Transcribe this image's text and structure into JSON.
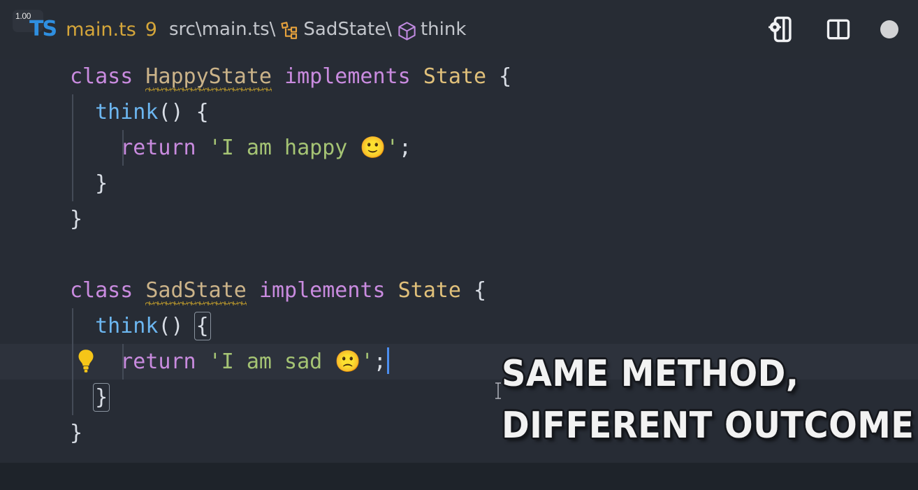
{
  "window": {
    "zoom_badge": "1.00",
    "file_icon": "TS",
    "tab_name": "main.ts",
    "tab_badge": "9",
    "theme": {
      "titlebar_bg": "#272c34",
      "editor_bg": "#272c35",
      "active_line_bg": "#2d323c",
      "accent_blue": "#4c8ef0",
      "tab_amber": "#d5a63a",
      "ts_blue": "#2f8fe0"
    }
  },
  "breadcrumb": {
    "items": [
      {
        "label": "src\\main.ts\\",
        "icon": "none"
      },
      {
        "label": "SadState\\",
        "icon": "class-symbol-icon"
      },
      {
        "label": "think",
        "icon": "method-symbol-icon"
      }
    ]
  },
  "titlebar_actions": [
    {
      "name": "open-settings-panel-icon",
      "label": "Settings"
    },
    {
      "name": "split-editor-icon",
      "label": "Split Editor"
    },
    {
      "name": "unsaved-dot-icon",
      "label": "Unsaved changes"
    }
  ],
  "editor": {
    "lines": [
      {
        "n": 1,
        "tokens": [
          {
            "t": "class",
            "c": "kw"
          },
          {
            "t": " ",
            "c": "punc"
          },
          {
            "t": "HappyState",
            "c": "type squiggle"
          },
          {
            "t": " ",
            "c": "punc"
          },
          {
            "t": "implements",
            "c": "kw"
          },
          {
            "t": " ",
            "c": "punc"
          },
          {
            "t": "State",
            "c": "iface"
          },
          {
            "t": " {",
            "c": "punc"
          }
        ]
      },
      {
        "n": 2,
        "indent": 1,
        "tokens": [
          {
            "t": "  ",
            "c": "punc"
          },
          {
            "t": "think",
            "c": "fn"
          },
          {
            "t": "() {",
            "c": "punc"
          }
        ]
      },
      {
        "n": 3,
        "indent": 2,
        "tokens": [
          {
            "t": "    ",
            "c": "punc"
          },
          {
            "t": "return",
            "c": "kw"
          },
          {
            "t": " ",
            "c": "punc"
          },
          {
            "t": "'I am happy 🙂'",
            "c": "str"
          },
          {
            "t": ";",
            "c": "punc"
          }
        ]
      },
      {
        "n": 4,
        "indent": 1,
        "tokens": [
          {
            "t": "  }",
            "c": "punc"
          }
        ]
      },
      {
        "n": 5,
        "tokens": [
          {
            "t": "}",
            "c": "punc"
          }
        ]
      },
      {
        "n": 6,
        "tokens": []
      },
      {
        "n": 7,
        "tokens": [
          {
            "t": "class",
            "c": "kw"
          },
          {
            "t": " ",
            "c": "punc"
          },
          {
            "t": "SadState",
            "c": "type squiggle"
          },
          {
            "t": " ",
            "c": "punc"
          },
          {
            "t": "implements",
            "c": "kw"
          },
          {
            "t": " ",
            "c": "punc"
          },
          {
            "t": "State",
            "c": "iface"
          },
          {
            "t": " {",
            "c": "punc"
          }
        ]
      },
      {
        "n": 8,
        "indent": 1,
        "tokens": [
          {
            "t": "  ",
            "c": "punc"
          },
          {
            "t": "think",
            "c": "fn"
          },
          {
            "t": "() ",
            "c": "punc"
          },
          {
            "t": "{",
            "c": "punc bracket-box"
          }
        ]
      },
      {
        "n": 9,
        "indent": 2,
        "active": true,
        "bulb": true,
        "caret": true,
        "tokens": [
          {
            "t": "    ",
            "c": "punc"
          },
          {
            "t": "return",
            "c": "kw"
          },
          {
            "t": " ",
            "c": "punc"
          },
          {
            "t": "'I am sad 🙁'",
            "c": "str"
          },
          {
            "t": ";",
            "c": "punc"
          }
        ]
      },
      {
        "n": 10,
        "indent": 1,
        "tokens": [
          {
            "t": "  ",
            "c": "punc"
          },
          {
            "t": "}",
            "c": "punc bracket-box"
          }
        ]
      },
      {
        "n": 11,
        "tokens": [
          {
            "t": "}",
            "c": "punc"
          }
        ]
      }
    ]
  },
  "caption": {
    "line1": "SAME METHOD,",
    "line2": "DIFFERENT OUTCOME"
  }
}
